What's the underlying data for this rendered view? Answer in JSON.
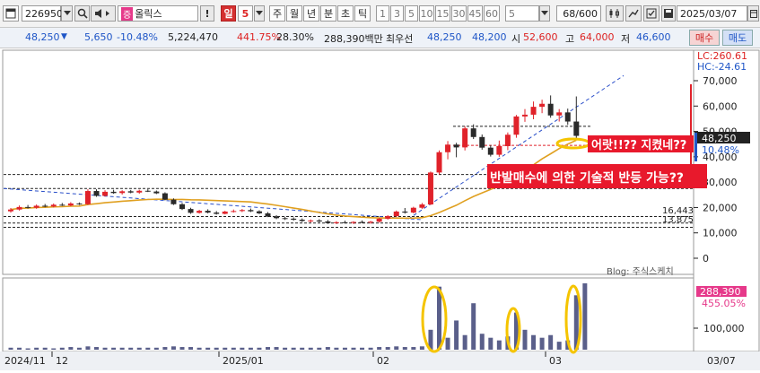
{
  "toolbar": {
    "code": "226950",
    "stock_badge": "증",
    "stock_name": "올릭스",
    "period_buttons": [
      "일",
      "5",
      "주",
      "월",
      "년",
      "분",
      "초",
      "틱"
    ],
    "active_period": "일",
    "minute_buttons": [
      "1",
      "3",
      "5",
      "10",
      "15",
      "30",
      "45",
      "60"
    ],
    "interval_value": "5",
    "count": "68/600",
    "date": "2025/03/07"
  },
  "quote": {
    "price": "48,250",
    "change": "5,650",
    "change_pct": "-10.48%",
    "volume": "5,224,470",
    "vol_ratio": "441.75%",
    "turnover": "28.30%",
    "amount": "288,390백만",
    "best_label": "최우선",
    "ask": "48,250",
    "bid": "48,200",
    "open_label": "시",
    "open": "52,600",
    "high_label": "고",
    "high": "64,000",
    "low_label": "저",
    "low": "46,600",
    "buy_label": "매수",
    "sell_label": "매도"
  },
  "price_axis": {
    "ticks": [
      "70,000",
      "60,000",
      "50,000",
      "40,000",
      "30,000",
      "20,000",
      "10,000",
      "0"
    ],
    "lc": "LC:260.61",
    "hc": "HC:-24.61",
    "current": "48,250",
    "current_pct": "10.48%",
    "level_1": "16,443",
    "level_2": "13,875"
  },
  "volume_axis": {
    "value": "288,390",
    "pct": "455.05%",
    "tick": "100,000"
  },
  "x_axis": {
    "labels": [
      "2024/11",
      "12",
      "2025/01",
      "02",
      "03",
      "03/07"
    ]
  },
  "annotations": {
    "note1": "어랏!!?? 지켰네??",
    "note2": "반발매수에 의한 기술적 반등 가능??",
    "watermark": "Blog: 주식스케치"
  },
  "colors": {
    "up": "#e0222a",
    "down": "#2a2a2a",
    "ma": "#e0a020",
    "highlight": "#f5c400",
    "note_bg": "#e8192c"
  },
  "chart_data": {
    "type": "candlestick",
    "ylim": [
      0,
      75000
    ],
    "candles": [
      {
        "o": 18500,
        "h": 19800,
        "l": 18000,
        "c": 19200
      },
      {
        "o": 19200,
        "h": 20800,
        "l": 18800,
        "c": 20200
      },
      {
        "o": 20200,
        "h": 21000,
        "l": 19600,
        "c": 19900
      },
      {
        "o": 19900,
        "h": 21200,
        "l": 19500,
        "c": 20700
      },
      {
        "o": 20700,
        "h": 21400,
        "l": 20100,
        "c": 20400
      },
      {
        "o": 20400,
        "h": 21600,
        "l": 20000,
        "c": 21100
      },
      {
        "o": 21100,
        "h": 21800,
        "l": 20600,
        "c": 20800
      },
      {
        "o": 20800,
        "h": 22100,
        "l": 20500,
        "c": 21600
      },
      {
        "o": 21600,
        "h": 22000,
        "l": 21000,
        "c": 21300
      },
      {
        "o": 21300,
        "h": 27200,
        "l": 21000,
        "c": 26500
      },
      {
        "o": 26500,
        "h": 27200,
        "l": 24200,
        "c": 24600
      },
      {
        "o": 24600,
        "h": 26800,
        "l": 24300,
        "c": 26200
      },
      {
        "o": 26200,
        "h": 27000,
        "l": 25400,
        "c": 25700
      },
      {
        "o": 25700,
        "h": 26800,
        "l": 25100,
        "c": 26400
      },
      {
        "o": 26400,
        "h": 26900,
        "l": 25600,
        "c": 25900
      },
      {
        "o": 25900,
        "h": 27000,
        "l": 25400,
        "c": 26600
      },
      {
        "o": 26600,
        "h": 27200,
        "l": 26100,
        "c": 26300
      },
      {
        "o": 26300,
        "h": 26700,
        "l": 25300,
        "c": 25600
      },
      {
        "o": 25600,
        "h": 26000,
        "l": 22800,
        "c": 23100
      },
      {
        "o": 23100,
        "h": 23600,
        "l": 21000,
        "c": 21300
      },
      {
        "o": 21300,
        "h": 21800,
        "l": 19000,
        "c": 19400
      },
      {
        "o": 19400,
        "h": 19900,
        "l": 17500,
        "c": 17900
      },
      {
        "o": 17900,
        "h": 19100,
        "l": 17600,
        "c": 18700
      },
      {
        "o": 18700,
        "h": 19300,
        "l": 17700,
        "c": 18000
      },
      {
        "o": 18000,
        "h": 18600,
        "l": 17200,
        "c": 17500
      },
      {
        "o": 17500,
        "h": 18700,
        "l": 17300,
        "c": 18400
      },
      {
        "o": 18400,
        "h": 19200,
        "l": 18000,
        "c": 18600
      },
      {
        "o": 18600,
        "h": 19400,
        "l": 18200,
        "c": 19000
      },
      {
        "o": 19000,
        "h": 19600,
        "l": 18200,
        "c": 18500
      },
      {
        "o": 18500,
        "h": 18900,
        "l": 17400,
        "c": 17700
      },
      {
        "o": 17700,
        "h": 18200,
        "l": 16200,
        "c": 16500
      },
      {
        "o": 16500,
        "h": 17000,
        "l": 15400,
        "c": 15800
      },
      {
        "o": 15800,
        "h": 16300,
        "l": 15100,
        "c": 15600
      },
      {
        "o": 15600,
        "h": 16100,
        "l": 14800,
        "c": 15200
      },
      {
        "o": 15200,
        "h": 15700,
        "l": 14300,
        "c": 14700
      },
      {
        "o": 14700,
        "h": 15300,
        "l": 14100,
        "c": 14900
      },
      {
        "o": 14900,
        "h": 15400,
        "l": 14200,
        "c": 14500
      },
      {
        "o": 14500,
        "h": 15100,
        "l": 13600,
        "c": 13900
      },
      {
        "o": 13900,
        "h": 14600,
        "l": 13500,
        "c": 14200
      },
      {
        "o": 14200,
        "h": 14800,
        "l": 13700,
        "c": 14000
      },
      {
        "o": 14000,
        "h": 14600,
        "l": 13500,
        "c": 14300
      },
      {
        "o": 14300,
        "h": 14900,
        "l": 13800,
        "c": 14100
      },
      {
        "o": 14100,
        "h": 14700,
        "l": 13600,
        "c": 14400
      },
      {
        "o": 14400,
        "h": 15900,
        "l": 14000,
        "c": 15600
      },
      {
        "o": 15600,
        "h": 17000,
        "l": 15200,
        "c": 16600
      },
      {
        "o": 16600,
        "h": 18800,
        "l": 16200,
        "c": 18400
      },
      {
        "o": 18400,
        "h": 19800,
        "l": 17600,
        "c": 18000
      },
      {
        "o": 18000,
        "h": 20300,
        "l": 17700,
        "c": 19900
      },
      {
        "o": 19900,
        "h": 21800,
        "l": 19400,
        "c": 21200
      },
      {
        "o": 21200,
        "h": 34200,
        "l": 21000,
        "c": 33800
      },
      {
        "o": 33800,
        "h": 42500,
        "l": 33000,
        "c": 41800
      },
      {
        "o": 41800,
        "h": 46200,
        "l": 39000,
        "c": 44800
      },
      {
        "o": 44800,
        "h": 45500,
        "l": 39800,
        "c": 43700
      },
      {
        "o": 43700,
        "h": 52000,
        "l": 42500,
        "c": 51200
      },
      {
        "o": 51200,
        "h": 52800,
        "l": 47000,
        "c": 47800
      },
      {
        "o": 47800,
        "h": 48800,
        "l": 42800,
        "c": 43600
      },
      {
        "o": 43600,
        "h": 44600,
        "l": 40100,
        "c": 40800
      },
      {
        "o": 40800,
        "h": 46400,
        "l": 40000,
        "c": 44200
      },
      {
        "o": 44200,
        "h": 49600,
        "l": 42600,
        "c": 48700
      },
      {
        "o": 48700,
        "h": 56500,
        "l": 47500,
        "c": 55900
      },
      {
        "o": 55900,
        "h": 58800,
        "l": 53800,
        "c": 56600
      },
      {
        "o": 56600,
        "h": 61800,
        "l": 54800,
        "c": 59700
      },
      {
        "o": 59700,
        "h": 62500,
        "l": 57200,
        "c": 60900
      },
      {
        "o": 60900,
        "h": 64200,
        "l": 55400,
        "c": 56300
      },
      {
        "o": 56300,
        "h": 58800,
        "l": 53900,
        "c": 57500
      },
      {
        "o": 57500,
        "h": 59000,
        "l": 52600,
        "c": 53900
      },
      {
        "o": 53900,
        "h": 63800,
        "l": 46600,
        "c": 48250
      }
    ],
    "volume": [
      3,
      3,
      2,
      3,
      3,
      2,
      3,
      4,
      3,
      5,
      4,
      3,
      3,
      3,
      3,
      3,
      3,
      3,
      4,
      5,
      4,
      4,
      3,
      3,
      3,
      3,
      3,
      3,
      3,
      3,
      4,
      4,
      3,
      3,
      3,
      3,
      3,
      4,
      3,
      3,
      3,
      3,
      3,
      4,
      4,
      5,
      4,
      4,
      5,
      30,
      95,
      18,
      44,
      22,
      70,
      24,
      18,
      14,
      20,
      56,
      30,
      22,
      18,
      22,
      12,
      14,
      82,
      100
    ]
  }
}
